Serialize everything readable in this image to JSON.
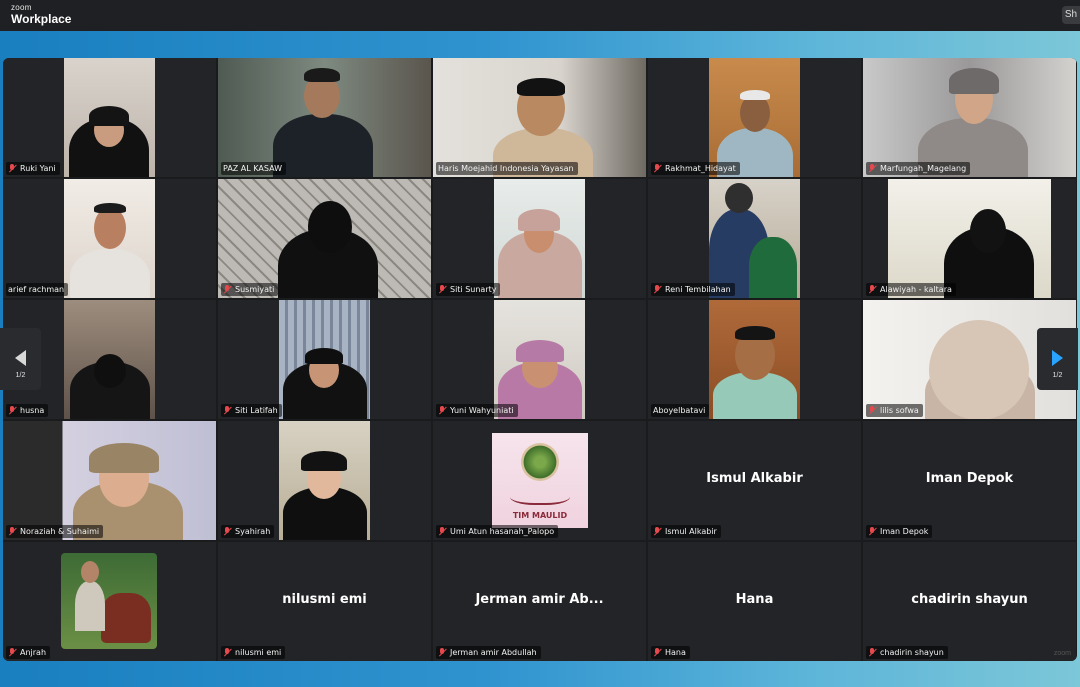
{
  "app": {
    "brand_small": "zoom",
    "brand_big": "Workplace",
    "top_right_text": "Sh"
  },
  "gallery": {
    "page_indicator_left": "1/2",
    "page_indicator_right": "1/2",
    "watermark": "zoom",
    "participants": [
      {
        "name": "Ruki Yani",
        "muted": true,
        "video": true
      },
      {
        "name": "PAZ AL KASAW",
        "muted": false,
        "video": true,
        "active": true
      },
      {
        "name": "Haris Moejahid Indonesia Yayasan",
        "muted": false,
        "video": true
      },
      {
        "name": "Rakhmat_Hidayat",
        "muted": true,
        "video": true
      },
      {
        "name": "Marfungah_Magelang",
        "muted": true,
        "video": true
      },
      {
        "name": "arief rachman",
        "muted": false,
        "video": true
      },
      {
        "name": "Susmiyati",
        "muted": true,
        "video": true
      },
      {
        "name": "Siti Sunarty",
        "muted": true,
        "video": true
      },
      {
        "name": "Reni Tembilahan",
        "muted": true,
        "video": true
      },
      {
        "name": "Alawiyah - kaltara",
        "muted": true,
        "video": true
      },
      {
        "name": "husna",
        "muted": true,
        "video": true
      },
      {
        "name": "Siti Latifah",
        "muted": true,
        "video": true
      },
      {
        "name": "Yuni Wahyuniati",
        "muted": true,
        "video": true
      },
      {
        "name": "Aboyelbatavi",
        "muted": false,
        "video": true
      },
      {
        "name": "lilis sofwa",
        "muted": true,
        "video": true
      },
      {
        "name": "Noraziah & Suhaimi",
        "muted": true,
        "video": true
      },
      {
        "name": "Syahirah",
        "muted": true,
        "video": true
      },
      {
        "name": "Umi Atun hasanah_Palopo",
        "muted": true,
        "video": false,
        "avatar_caption": "TIM MAULID"
      },
      {
        "name": "Ismul Alkabir",
        "muted": true,
        "video": false,
        "display": "Ismul Alkabir"
      },
      {
        "name": "Iman Depok",
        "muted": true,
        "video": false,
        "display": "Iman Depok"
      },
      {
        "name": "Anjrah",
        "muted": true,
        "video": true
      },
      {
        "name": "nilusmi emi",
        "muted": true,
        "video": false,
        "display": "nilusmi emi"
      },
      {
        "name": "Jerman amir Abdullah",
        "muted": true,
        "video": false,
        "display": "Jerman amir Ab..."
      },
      {
        "name": "Hana",
        "muted": true,
        "video": false,
        "display": "Hana"
      },
      {
        "name": "chadirin shayun",
        "muted": true,
        "video": false,
        "display": "chadirin shayun"
      }
    ]
  },
  "colors": {
    "active_speaker": "#3fd59a",
    "mute": "#e5484d",
    "nav_arrow": "#2aa3ff"
  }
}
